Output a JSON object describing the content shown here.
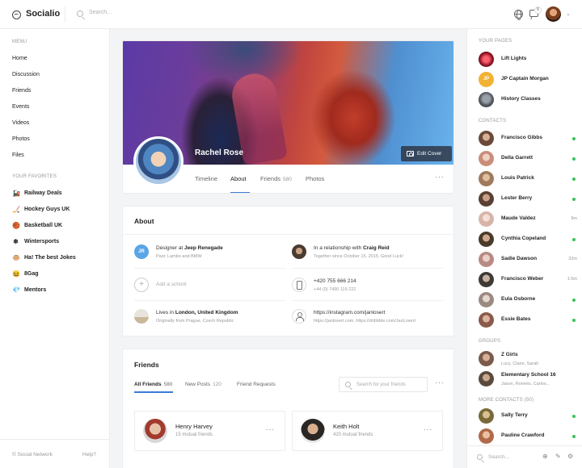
{
  "app": {
    "name": "Socialio"
  },
  "topbar": {
    "search_placeholder": "Search...",
    "notification_count": "5",
    "more": "⌄"
  },
  "left": {
    "menu_title": "MENU",
    "menu": [
      "Home",
      "Discussion",
      "Friends",
      "Events",
      "Videos",
      "Photos",
      "Files"
    ],
    "favorites_title": "YOUR FAVORITES",
    "favorites": [
      {
        "label": "Railway Deals",
        "icon": "train-icon",
        "glyph": "🚂"
      },
      {
        "label": "Hockey Guys UK",
        "icon": "hockey-icon",
        "glyph": "🏒"
      },
      {
        "label": "Basketball UK",
        "icon": "basketball-icon",
        "glyph": "🏀"
      },
      {
        "label": "Wintersports",
        "icon": "snowflake-icon",
        "glyph": "❄"
      },
      {
        "label": "Ha! The best Jokes",
        "icon": "monkey-icon",
        "glyph": "🐵"
      },
      {
        "label": "8Gag",
        "icon": "laugh-icon",
        "glyph": "😆"
      },
      {
        "label": "Mentors",
        "icon": "diamond-icon",
        "glyph": "💎"
      }
    ],
    "footer_copy": "© Social Network",
    "footer_help": "Help?"
  },
  "profile": {
    "name": "Rachel Rose",
    "edit_cover": "Edit Cover",
    "tabs": [
      {
        "label": "Timeline",
        "count": ""
      },
      {
        "label": "About",
        "count": ""
      },
      {
        "label": "Friends",
        "count": "580"
      },
      {
        "label": "Photos",
        "count": ""
      }
    ],
    "more": "···"
  },
  "about": {
    "title": "About",
    "work_prefix": "Designer at ",
    "work_company": "Jeep Renegade",
    "work_past": "Past: Lambo and BMW",
    "work_badge": "JR",
    "rel_prefix": "In a relationship with ",
    "rel_name": "Craig Reid",
    "rel_since": "Together since October 15, 2015. Good Luck!",
    "add_school": "Add a school",
    "phone": "+420 755 666 214",
    "phone2": "+44 (0) 7490 119 222",
    "lives_prefix": "Lives in ",
    "lives_city": "London, United Kingdom",
    "lives_origin": "Originally from Prague, Czech Republic",
    "website": "https://instagram.com/janlosert",
    "website_more": "https://janlosert.com, https://dribbble.com/JanLosert"
  },
  "friends": {
    "title": "Friends",
    "tabs": [
      {
        "label": "All Friends",
        "count": "580"
      },
      {
        "label": "New Posts",
        "count": "120"
      },
      {
        "label": "Friend Requests",
        "count": ""
      }
    ],
    "search_placeholder": "Search for your friends",
    "list": [
      {
        "name": "Henry Harvey",
        "mutual": "15 mutual friends"
      },
      {
        "name": "Keith Holt",
        "mutual": "420 mutual friends"
      }
    ]
  },
  "right": {
    "pages_title": "YOUR PAGES",
    "pages": [
      {
        "name": "Lift Lights",
        "color": "#c0283a"
      },
      {
        "name": "JP Captain Morgan",
        "color": "#f2b233",
        "initials": "JP"
      },
      {
        "name": "History Classes",
        "color": "#6e7480"
      }
    ],
    "contacts_title": "CONTACTS",
    "contacts": [
      {
        "name": "Francisco Gibbs",
        "status": "online",
        "time": "",
        "color": "#6b4a3a"
      },
      {
        "name": "Della Garrett",
        "status": "online",
        "time": "",
        "color": "#c98e7a"
      },
      {
        "name": "Louis Patrick",
        "status": "online",
        "time": "",
        "color": "#a07a5c"
      },
      {
        "name": "Lester Berry",
        "status": "online",
        "time": "",
        "color": "#5a4034"
      },
      {
        "name": "Maude Valdez",
        "status": "away",
        "time": "9m",
        "color": "#d8b4a8"
      },
      {
        "name": "Cynthia Copeland",
        "status": "online",
        "time": "",
        "color": "#4a3a2a"
      },
      {
        "name": "Sadie Dawson",
        "status": "away",
        "time": "32m",
        "color": "#b88a84"
      },
      {
        "name": "Francisco Weber",
        "status": "away",
        "time": "1:5m",
        "color": "#3e3a36"
      },
      {
        "name": "Eula Osborne",
        "status": "online",
        "time": "",
        "color": "#9a8a82"
      },
      {
        "name": "Essie Bates",
        "status": "online",
        "time": "",
        "color": "#8a5a4a"
      }
    ],
    "groups_title": "GROUPS",
    "groups": [
      {
        "name": "Z Girls",
        "members": "Lucy, Claire, Sarah",
        "color": "#7a5a4a"
      },
      {
        "name": "Elementary School 16",
        "members": "Jason, Romelu, Carlos...",
        "color": "#5a4a3e"
      }
    ],
    "more_title": "MORE CONTACTS (50)",
    "more": [
      {
        "name": "Sally Terry",
        "status": "online",
        "color": "#7a6a3a"
      },
      {
        "name": "Pauline Crawford",
        "status": "online",
        "color": "#b06a4a"
      }
    ],
    "search_placeholder": "Search..."
  }
}
